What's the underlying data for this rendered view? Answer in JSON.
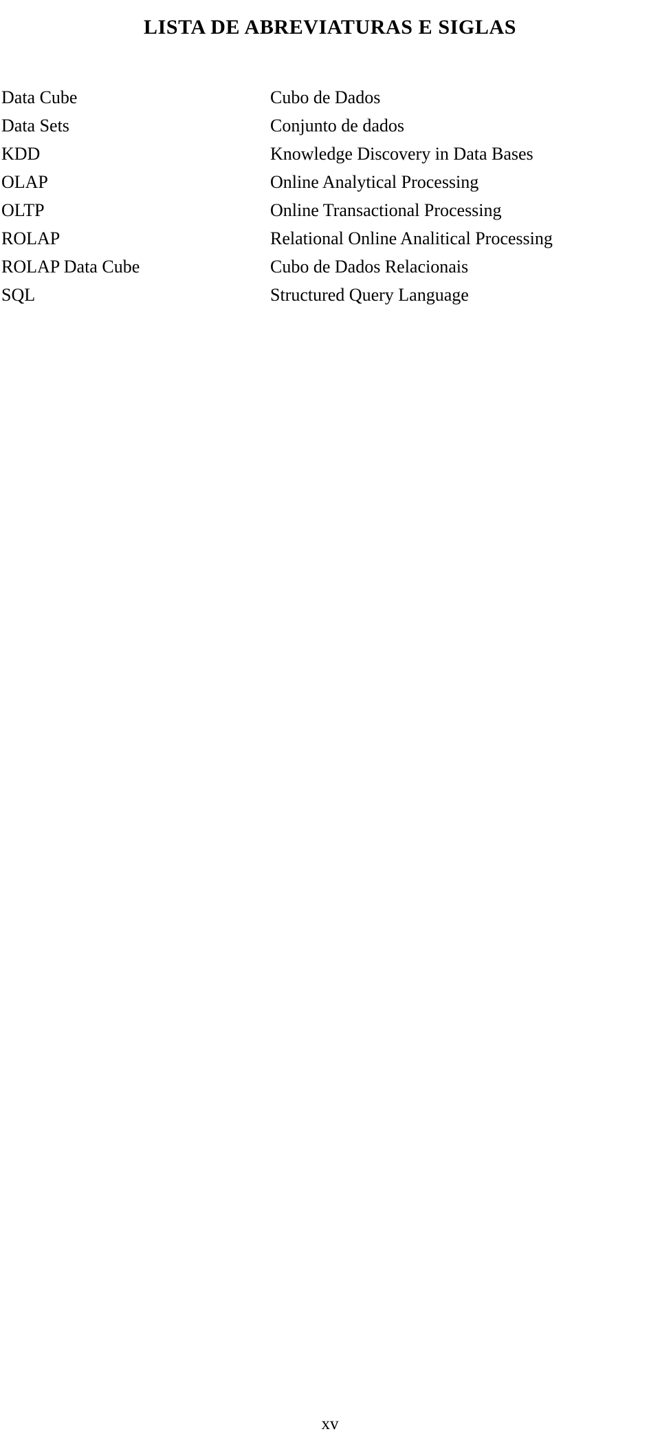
{
  "document": {
    "heading": "LISTA DE ABREVIATURAS E SIGLAS",
    "page_number": "xv",
    "text_color": "#000000",
    "background_color": "#ffffff"
  },
  "abbreviations": [
    {
      "term": "Data Cube",
      "definition": "Cubo de Dados"
    },
    {
      "term": "Data Sets",
      "definition": "Conjunto de dados"
    },
    {
      "term": "KDD",
      "definition": "Knowledge Discovery in Data Bases"
    },
    {
      "term": "OLAP",
      "definition": "Online Analytical Processing"
    },
    {
      "term": "OLTP",
      "definition": "Online Transactional Processing"
    },
    {
      "term": "ROLAP",
      "definition": "Relational Online Analitical Processing"
    },
    {
      "term": "ROLAP Data Cube",
      "definition": "Cubo de Dados Relacionais"
    },
    {
      "term": "SQL",
      "definition": "Structured Query Language"
    }
  ]
}
